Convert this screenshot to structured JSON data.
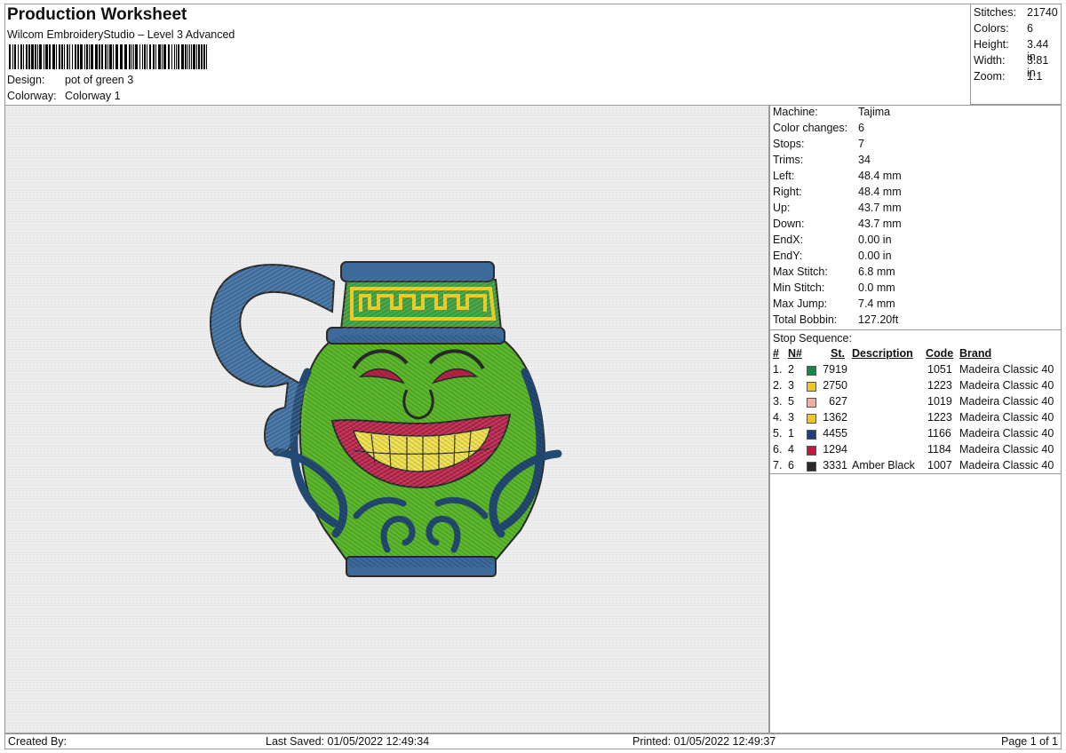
{
  "header": {
    "title": "Production Worksheet",
    "subtitle": "Wilcom EmbroideryStudio – Level 3 Advanced",
    "design_label": "Design:",
    "design_value": "pot of green 3",
    "colorway_label": "Colorway:",
    "colorway_value": "Colorway 1"
  },
  "stats": [
    {
      "label": "Stitches:",
      "value": "21740"
    },
    {
      "label": "Colors:",
      "value": "6"
    },
    {
      "label": "Height:",
      "value": "3.44 in"
    },
    {
      "label": "Width:",
      "value": "3.81 in"
    },
    {
      "label": "Zoom:",
      "value": "1:1"
    }
  ],
  "machine_info": [
    {
      "label": "Machine:",
      "value": "Tajima"
    },
    {
      "label": "Color changes:",
      "value": "6"
    },
    {
      "label": "Stops:",
      "value": "7"
    },
    {
      "label": "Trims:",
      "value": "34"
    },
    {
      "label": "Left:",
      "value": "48.4 mm"
    },
    {
      "label": "Right:",
      "value": "48.4 mm"
    },
    {
      "label": "Up:",
      "value": "43.7 mm"
    },
    {
      "label": "Down:",
      "value": "43.7 mm"
    },
    {
      "label": "EndX:",
      "value": "0.00 in"
    },
    {
      "label": "EndY:",
      "value": "0.00 in"
    },
    {
      "label": "Max Stitch:",
      "value": "6.8 mm"
    },
    {
      "label": "Min Stitch:",
      "value": "0.0 mm"
    },
    {
      "label": "Max Jump:",
      "value": "7.4 mm"
    },
    {
      "label": "Total Bobbin:",
      "value": "127.20ft"
    }
  ],
  "stop_sequence": {
    "label": "Stop Sequence:",
    "headers": {
      "num": "#",
      "n": "N#",
      "st": "St.",
      "description": "Description",
      "code": "Code",
      "brand": "Brand"
    },
    "rows": [
      {
        "num": "1.",
        "n": "2",
        "color": "#0f8a4a",
        "st": "7919",
        "description": "",
        "code": "1051",
        "brand": "Madeira Classic 40"
      },
      {
        "num": "2.",
        "n": "3",
        "color": "#f2c521",
        "st": "2750",
        "description": "",
        "code": "1223",
        "brand": "Madeira Classic 40"
      },
      {
        "num": "3.",
        "n": "5",
        "color": "#f2b0a2",
        "st": "627",
        "description": "",
        "code": "1019",
        "brand": "Madeira Classic 40"
      },
      {
        "num": "4.",
        "n": "3",
        "color": "#f2c521",
        "st": "1362",
        "description": "",
        "code": "1223",
        "brand": "Madeira Classic 40"
      },
      {
        "num": "5.",
        "n": "1",
        "color": "#1e3f86",
        "st": "4455",
        "description": "",
        "code": "1166",
        "brand": "Madeira Classic 40"
      },
      {
        "num": "6.",
        "n": "4",
        "color": "#c4163f",
        "st": "1294",
        "description": "",
        "code": "1184",
        "brand": "Madeira Classic 40"
      },
      {
        "num": "7.",
        "n": "6",
        "color": "#2a2a2a",
        "st": "3331",
        "description": "Amber Black",
        "code": "1007",
        "brand": "Madeira Classic 40"
      }
    ]
  },
  "footer": {
    "created_by": "Created By:",
    "last_saved": "Last Saved: 01/05/2022 12:49:34",
    "printed": "Printed: 01/05/2022 12:49:37",
    "page": "Page 1 of 1"
  },
  "design_colors": {
    "pot_blue": "#3c6a9a",
    "pot_blue_dark": "#234a72",
    "band_green": "#3c9a3a",
    "band_gold": "#e8c81e",
    "body_green": "#5cb82c",
    "mouth_red": "#b8234a",
    "teeth": "#f0e04a",
    "outline": "#2a2a2a"
  }
}
